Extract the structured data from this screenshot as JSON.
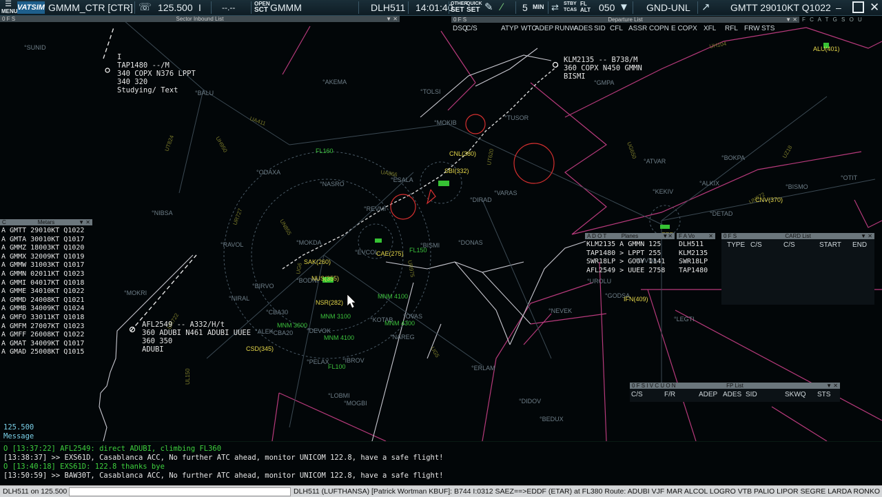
{
  "topbar": {
    "menu_label": "MENU",
    "brand": "VATSIM",
    "station": "GMMM_CTR [CTR]",
    "frequency": "125.500",
    "freq_sep": "I",
    "squawk": "--.--",
    "open_label": "OPEN",
    "sct_label": "SCT",
    "sector": "GMMM",
    "callsign": "DLH511",
    "time": "14:01:40",
    "other_label": "OTHER",
    "quick_label": "QUICK",
    "set_label": "SET",
    "range": "5",
    "min_label": "MIN",
    "stby_label": "STBY",
    "tcas_label": "TCAS",
    "fl_label": "FL",
    "alt_label": "ALT",
    "level": "050",
    "gnd_unl": "GND-UNL",
    "metar": "GMTT 29010KT Q1022",
    "colors": {
      "bar": "#16262f",
      "text": "#e6eef2"
    }
  },
  "sector_inbound": {
    "title": "Sector Inbound List",
    "flags": "0 F S"
  },
  "departure_list": {
    "title": "Departure List",
    "flags": "0 F S",
    "columns": [
      "DSQ",
      "C/S",
      "ATYP",
      "WTC",
      "ADEP",
      "RUNW",
      "ADES",
      "SID",
      "CFL",
      "ASSR",
      "COPN",
      "E COPX",
      "XFL",
      "RFL",
      "FRW",
      "STS"
    ]
  },
  "right_flags": "F C A T G S O U",
  "metars": {
    "title": "Metars",
    "flag": "C",
    "rows": [
      "A GMTT 29010KT Q1022",
      "A GMTA 30010KT Q1017",
      "A GMMZ 18003KT Q1020",
      "A GMMX 32009KT Q1019",
      "A GMMW 31003KT Q1017",
      "A GMMN 02011KT Q1023",
      "A GMMI 04017KT Q1018",
      "A GMME 34010KT Q1022",
      "A GMMD 24008KT Q1021",
      "A GMMB 34009KT Q1024",
      "A GMFO 33011KT Q1018",
      "A GMFM 27007KT Q1023",
      "A GMFF 26008KT Q1022",
      "A GMAT 34009KT Q1017",
      "A GMAD 25008KT Q1015"
    ]
  },
  "planes": {
    "title": "Planes",
    "flags": "A D O T",
    "rows": [
      "KLM2135  A GMMN 125",
      "TAP1480  > LPPT 255",
      "SWR18LP  > GOOY 1141",
      "AFL2549  > UUEE 2758"
    ]
  },
  "vo_list": {
    "flags": "F A Vo",
    "rows": [
      "DLH511",
      "KLM2135",
      "SWR18LP",
      "TAP1480"
    ]
  },
  "card_list": {
    "title": "CARD List",
    "flags": "0 F S",
    "columns": [
      "TYPE",
      "C/S",
      "C/S",
      "START",
      "END"
    ]
  },
  "fp_list": {
    "title": "FP List",
    "flags": "0 F S I V C U O N",
    "columns": [
      "C/S",
      "F/R",
      "ADEP",
      "ADES",
      "SID",
      "SKWQ",
      "STS"
    ]
  },
  "tracks": [
    {
      "lines": [
        "I",
        "TAP1480 --/M",
        "340 COPX N376 LPPT",
        "340 320",
        "Studying/ Text"
      ]
    },
    {
      "lines": [
        "KLM2135 -- B738/M",
        "360 COPX N450 GMMN",
        "BISMI"
      ]
    },
    {
      "lines": [
        "AFL2549 -- A332/H/t",
        "360 ADUBI N461 ADUBI UUEE",
        "360 350",
        "ADUBI"
      ]
    }
  ],
  "waypoints": [
    "SUNID",
    "BALU",
    "AKEMA",
    "TOLSI",
    "MOKIB",
    "TUSOR",
    "GMPA",
    "ODAXA",
    "NASRO",
    "ESALA",
    "NIBSA",
    "REVMI",
    "DIRAD",
    "VARAS",
    "ATVAR",
    "BOKPA",
    "KEKIV",
    "ALKIX",
    "RAVOL",
    "MOKDA",
    "EVCOL",
    "BISMI",
    "DONAS",
    "DETAD",
    "OTIT",
    "BIRVO",
    "NIRAL",
    "BODNI",
    "UROLU",
    "GODSA",
    "NEVEK",
    "LEGTI",
    "CBA30",
    "DEVOK",
    "KOTAB",
    "OVAS",
    "NAREG",
    "PELAX",
    "IBROV",
    "ERLAM",
    "LOBMI",
    "MOGBI",
    "DIDOV",
    "BEDUX",
    "MOKRI",
    "CBA20",
    "GIVDA",
    "KLISA",
    "ALEK",
    "BISMO"
  ],
  "airport_labels": [
    "SAK(260)",
    "NUS(355)",
    "NSR(282)",
    "CSD(345)",
    "CNL(380)",
    "SBI(332)",
    "CAE(275)",
    "ALU(401)",
    "CNV(370)",
    "FEZ",
    "IFN(409)"
  ],
  "altitude_labels": [
    "FL160",
    "FL150",
    "FL100",
    "MNM 4100",
    "MNM 3600",
    "MNM 3100",
    "MNM 4100",
    "MNM 4300"
  ],
  "airways": [
    "UH104",
    "UA411",
    "UH950",
    "UT824",
    "UA866",
    "UN855",
    "UR727",
    "UR975",
    "UT620",
    "UG650",
    "UN872",
    "UZ18",
    "UG5",
    "UG6",
    "UR722",
    "UL150"
  ],
  "message_box": {
    "frequency": "125.500",
    "label": "Message"
  },
  "messages": [
    {
      "prefix": "O",
      "time": "[13:37:22]",
      "text": "AFL2549: direct ADUBI, climbing FL360",
      "color": "#3ed13e"
    },
    {
      "prefix": " ",
      "time": "[13:38:37]",
      "text": ">> EXS61D, Casablanca ACC, No further ATC ahead, monitor UNICOM 122.8, have a safe flight!",
      "color": "#e8e8e8"
    },
    {
      "prefix": "O",
      "time": "[13:40:18]",
      "text": "EXS61D: 122.8 thanks bye",
      "color": "#3ed13e"
    },
    {
      "prefix": " ",
      "time": "[13:50:59]",
      "text": ">> BAW30T, Casablanca ACC, No further ATC ahead, monitor UNICOM 122.8, have a safe flight!",
      "color": "#e8e8e8"
    }
  ],
  "statusbar": {
    "left": "DLH511 on 125.500",
    "flightplan": "DLH511 (LUFTHANSA) [Patrick Wortman KBUF]: B744 I:0312 SAEZ==>EDDF (ETAR) at FL380 Route: ADUBI VJF MAR ALCOL LOGRO VTB PALIO LIPOR SEGRE LARDA RONKO LATEK"
  }
}
